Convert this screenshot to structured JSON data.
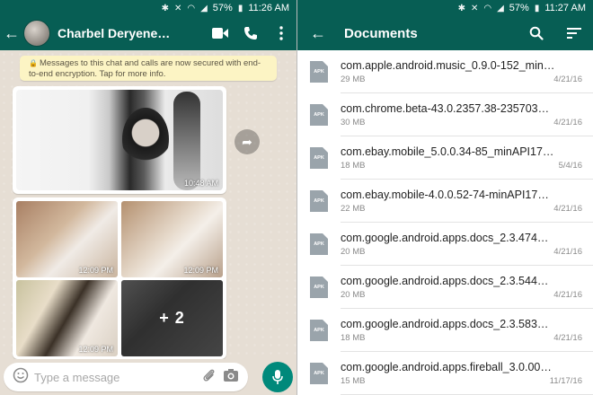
{
  "colors": {
    "header": "#075e54",
    "accent_fab": "#00897b",
    "notice_bg": "#fcf4c4",
    "chat_bg": "#e6ded4"
  },
  "left": {
    "status": {
      "battery": "57%",
      "time": "11:26 AM"
    },
    "header": {
      "contact_name": "Charbel Deryene…"
    },
    "encryption_notice": "Messages to this chat and calls are now secured with end-to-end encryption. Tap for more info.",
    "messages": [
      {
        "type": "image",
        "time": "10:48 AM"
      },
      {
        "type": "album",
        "tiles": [
          {
            "time": "12:09 PM"
          },
          {
            "time": "12:09 PM"
          },
          {
            "time": "12:09 PM"
          },
          {
            "more": "+ 2"
          }
        ]
      }
    ],
    "input": {
      "placeholder": "Type a message"
    }
  },
  "right": {
    "status": {
      "battery": "57%",
      "time": "11:27 AM"
    },
    "header": {
      "title": "Documents"
    },
    "file_icon_label": "APK",
    "documents": [
      {
        "name": "com.apple.android.music_0.9.0-152_min…",
        "size": "29 MB",
        "date": "4/21/16"
      },
      {
        "name": "com.chrome.beta-43.0.2357.38-235703…",
        "size": "30 MB",
        "date": "4/21/16"
      },
      {
        "name": "com.ebay.mobile_5.0.0.34-85_minAPI17…",
        "size": "18 MB",
        "date": "5/4/16"
      },
      {
        "name": "com.ebay.mobile-4.0.0.52-74-minAPI17…",
        "size": "22 MB",
        "date": "4/21/16"
      },
      {
        "name": "com.google.android.apps.docs_2.3.474…",
        "size": "20 MB",
        "date": "4/21/16"
      },
      {
        "name": "com.google.android.apps.docs_2.3.544…",
        "size": "20 MB",
        "date": "4/21/16"
      },
      {
        "name": "com.google.android.apps.docs_2.3.583…",
        "size": "18 MB",
        "date": "4/21/16"
      },
      {
        "name": "com.google.android.apps.fireball_3.0.00…",
        "size": "15 MB",
        "date": "11/17/16"
      }
    ]
  }
}
